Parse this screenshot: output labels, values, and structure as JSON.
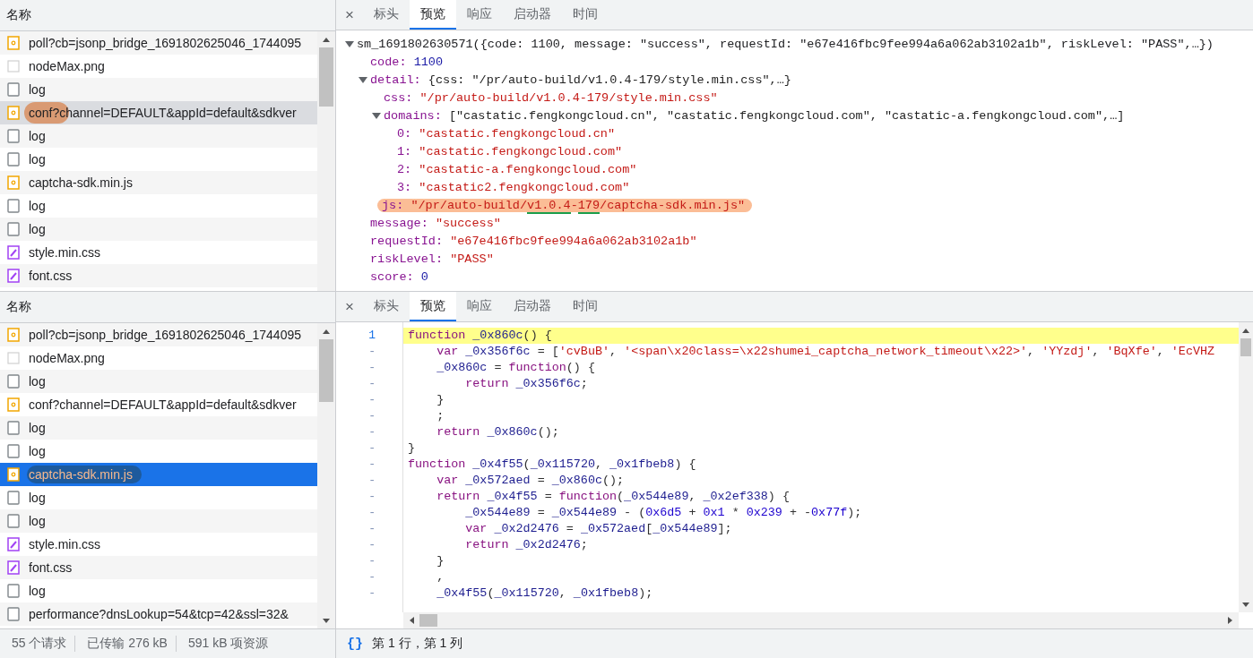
{
  "top": {
    "list": {
      "header": "名称",
      "selection_focused": false,
      "rows": [
        {
          "name": "poll?cb=jsonp_bridge_1691802625046_1744095",
          "kind": "script",
          "selected": false,
          "annotated": false
        },
        {
          "name": "nodeMax.png",
          "kind": "image",
          "selected": false,
          "annotated": false
        },
        {
          "name": "log",
          "kind": "document",
          "selected": false,
          "annotated": false
        },
        {
          "name": "conf?channel=DEFAULT&appId=default&sdkver",
          "kind": "script",
          "selected": true,
          "annotated": true
        },
        {
          "name": "log",
          "kind": "document",
          "selected": false,
          "annotated": false
        },
        {
          "name": "log",
          "kind": "document",
          "selected": false,
          "annotated": false
        },
        {
          "name": "captcha-sdk.min.js",
          "kind": "script",
          "selected": false,
          "annotated": false
        },
        {
          "name": "log",
          "kind": "document",
          "selected": false,
          "annotated": false
        },
        {
          "name": "log",
          "kind": "document",
          "selected": false,
          "annotated": false
        },
        {
          "name": "style.min.css",
          "kind": "stylesheet",
          "selected": false,
          "annotated": false
        },
        {
          "name": "font.css",
          "kind": "stylesheet",
          "selected": false,
          "annotated": false
        }
      ]
    },
    "detail": {
      "close": "×",
      "tabs": [
        {
          "label": "标头",
          "selected": false
        },
        {
          "label": "预览",
          "selected": true
        },
        {
          "label": "响应",
          "selected": false
        },
        {
          "label": "启动器",
          "selected": false
        },
        {
          "label": "时间",
          "selected": false
        }
      ],
      "preview": {
        "label": "sm_1691802630571({code: 1100, message: \"success\", requestId: \"e67e416fbc9fee994a6a062ab3102a1b\", riskLevel: \"PASS\",…})",
        "expanded": true,
        "children": [
          {
            "key": "code:",
            "value": "1100",
            "kind": "number"
          },
          {
            "key": "detail:",
            "value": "{css: \"/pr/auto-build/v1.0.4-179/style.min.css\",…}",
            "kind": "preview",
            "expanded": true,
            "children": [
              {
                "key": "css:",
                "value": "\"/pr/auto-build/v1.0.4-179/style.min.css\"",
                "kind": "string"
              },
              {
                "key": "domains:",
                "value": "[\"castatic.fengkongcloud.cn\", \"castatic.fengkongcloud.com\", \"castatic-a.fengkongcloud.com\",…]",
                "kind": "preview",
                "expanded": true,
                "children": [
                  {
                    "key": "0:",
                    "value": "\"castatic.fengkongcloud.cn\"",
                    "kind": "string"
                  },
                  {
                    "key": "1:",
                    "value": "\"castatic.fengkongcloud.com\"",
                    "kind": "string"
                  },
                  {
                    "key": "2:",
                    "value": "\"castatic-a.fengkongcloud.com\"",
                    "kind": "string"
                  },
                  {
                    "key": "3:",
                    "value": "\"castatic2.fengkongcloud.com\"",
                    "kind": "string"
                  }
                ]
              },
              {
                "key": "js:",
                "kind": "string",
                "annotated": true,
                "value_parts": [
                  {
                    "text": "\"/pr/auto-build/",
                    "underlined": false
                  },
                  {
                    "text": "v1.0.4",
                    "underlined": true
                  },
                  {
                    "text": "-",
                    "underlined": false
                  },
                  {
                    "text": "179",
                    "underlined": true
                  },
                  {
                    "text": "/captcha-sdk.min.js\"",
                    "underlined": false
                  }
                ]
              }
            ]
          },
          {
            "key": "message:",
            "value": "\"success\"",
            "kind": "string"
          },
          {
            "key": "requestId:",
            "value": "\"e67e416fbc9fee994a6a062ab3102a1b\"",
            "kind": "string"
          },
          {
            "key": "riskLevel:",
            "value": "\"PASS\"",
            "kind": "string"
          },
          {
            "key": "score:",
            "value": "0",
            "kind": "number"
          }
        ]
      }
    }
  },
  "bottom": {
    "list": {
      "header": "名称",
      "selection_focused": true,
      "rows": [
        {
          "name": "poll?cb=jsonp_bridge_1691802625046_1744095",
          "kind": "script",
          "selected": false,
          "annotated": false
        },
        {
          "name": "nodeMax.png",
          "kind": "image",
          "selected": false,
          "annotated": false
        },
        {
          "name": "log",
          "kind": "document",
          "selected": false,
          "annotated": false
        },
        {
          "name": "conf?channel=DEFAULT&appId=default&sdkver",
          "kind": "script",
          "selected": false,
          "annotated": false
        },
        {
          "name": "log",
          "kind": "document",
          "selected": false,
          "annotated": false
        },
        {
          "name": "log",
          "kind": "document",
          "selected": false,
          "annotated": false
        },
        {
          "name": "captcha-sdk.min.js",
          "kind": "script",
          "selected": true,
          "annotated": true
        },
        {
          "name": "log",
          "kind": "document",
          "selected": false,
          "annotated": false
        },
        {
          "name": "log",
          "kind": "document",
          "selected": false,
          "annotated": false
        },
        {
          "name": "style.min.css",
          "kind": "stylesheet",
          "selected": false,
          "annotated": false
        },
        {
          "name": "font.css",
          "kind": "stylesheet",
          "selected": false,
          "annotated": false
        },
        {
          "name": "log",
          "kind": "document",
          "selected": false,
          "annotated": false
        },
        {
          "name": "performance?dnsLookup=54&tcp=42&ssl=32&",
          "kind": "document",
          "selected": false,
          "annotated": false
        }
      ],
      "footer": [
        "55 个请求",
        "已传输 276 kB",
        "591 kB 项资源"
      ]
    },
    "detail": {
      "close": "×",
      "tabs": [
        {
          "label": "标头",
          "selected": false
        },
        {
          "label": "预览",
          "selected": true
        },
        {
          "label": "响应",
          "selected": false
        },
        {
          "label": "启动器",
          "selected": false
        },
        {
          "label": "时间",
          "selected": false
        }
      ],
      "code": {
        "lines": [
          {
            "number": "1",
            "highlighted": true,
            "tokens": [
              {
                "kind": "keyword",
                "text": "function"
              },
              {
                "kind": "ident",
                "text": " _0x860c"
              },
              {
                "kind": "punct",
                "text": "() {"
              }
            ]
          },
          {
            "number": "-",
            "highlighted": false,
            "tokens": [
              {
                "kind": "keyword",
                "text": "    var"
              },
              {
                "kind": "ident",
                "text": " _0x356f6c"
              },
              {
                "kind": "punct",
                "text": " = ["
              },
              {
                "kind": "string",
                "text": "'cvBuB'"
              },
              {
                "kind": "punct",
                "text": ", "
              },
              {
                "kind": "string",
                "text": "'<span\\x20class=\\x22shumei_captcha_network_timeout\\x22>'"
              },
              {
                "kind": "punct",
                "text": ", "
              },
              {
                "kind": "string",
                "text": "'YYzdj'"
              },
              {
                "kind": "punct",
                "text": ", "
              },
              {
                "kind": "string",
                "text": "'BqXfe'"
              },
              {
                "kind": "punct",
                "text": ", "
              },
              {
                "kind": "string",
                "text": "'EcVHZ"
              }
            ]
          },
          {
            "number": "-",
            "highlighted": false,
            "tokens": [
              {
                "kind": "ident",
                "text": "    _0x860c"
              },
              {
                "kind": "punct",
                "text": " = "
              },
              {
                "kind": "keyword",
                "text": "function"
              },
              {
                "kind": "punct",
                "text": "() {"
              }
            ]
          },
          {
            "number": "-",
            "highlighted": false,
            "tokens": [
              {
                "kind": "keyword",
                "text": "        return"
              },
              {
                "kind": "ident",
                "text": " _0x356f6c"
              },
              {
                "kind": "punct",
                "text": ";"
              }
            ]
          },
          {
            "number": "-",
            "highlighted": false,
            "tokens": [
              {
                "kind": "punct",
                "text": "    }"
              }
            ]
          },
          {
            "number": "-",
            "highlighted": false,
            "tokens": [
              {
                "kind": "punct",
                "text": "    ;"
              }
            ]
          },
          {
            "number": "-",
            "highlighted": false,
            "tokens": [
              {
                "kind": "keyword",
                "text": "    return"
              },
              {
                "kind": "ident",
                "text": " _0x860c"
              },
              {
                "kind": "punct",
                "text": "();"
              }
            ]
          },
          {
            "number": "-",
            "highlighted": false,
            "tokens": [
              {
                "kind": "punct",
                "text": "}"
              }
            ]
          },
          {
            "number": "-",
            "highlighted": false,
            "tokens": [
              {
                "kind": "keyword",
                "text": "function"
              },
              {
                "kind": "ident",
                "text": " _0x4f55"
              },
              {
                "kind": "punct",
                "text": "("
              },
              {
                "kind": "ident",
                "text": "_0x115720"
              },
              {
                "kind": "punct",
                "text": ", "
              },
              {
                "kind": "ident",
                "text": "_0x1fbeb8"
              },
              {
                "kind": "punct",
                "text": ") {"
              }
            ]
          },
          {
            "number": "-",
            "highlighted": false,
            "tokens": [
              {
                "kind": "keyword",
                "text": "    var"
              },
              {
                "kind": "ident",
                "text": " _0x572aed"
              },
              {
                "kind": "punct",
                "text": " = "
              },
              {
                "kind": "ident",
                "text": "_0x860c"
              },
              {
                "kind": "punct",
                "text": "();"
              }
            ]
          },
          {
            "number": "-",
            "highlighted": false,
            "tokens": [
              {
                "kind": "keyword",
                "text": "    return"
              },
              {
                "kind": "ident",
                "text": " _0x4f55"
              },
              {
                "kind": "punct",
                "text": " = "
              },
              {
                "kind": "keyword",
                "text": "function"
              },
              {
                "kind": "punct",
                "text": "("
              },
              {
                "kind": "ident",
                "text": "_0x544e89"
              },
              {
                "kind": "punct",
                "text": ", "
              },
              {
                "kind": "ident",
                "text": "_0x2ef338"
              },
              {
                "kind": "punct",
                "text": ") {"
              }
            ]
          },
          {
            "number": "-",
            "highlighted": false,
            "tokens": [
              {
                "kind": "ident",
                "text": "        _0x544e89"
              },
              {
                "kind": "punct",
                "text": " = "
              },
              {
                "kind": "ident",
                "text": "_0x544e89"
              },
              {
                "kind": "punct",
                "text": " - ("
              },
              {
                "kind": "number",
                "text": "0x6d5"
              },
              {
                "kind": "punct",
                "text": " + "
              },
              {
                "kind": "number",
                "text": "0x1"
              },
              {
                "kind": "punct",
                "text": " * "
              },
              {
                "kind": "number",
                "text": "0x239"
              },
              {
                "kind": "punct",
                "text": " + -"
              },
              {
                "kind": "number",
                "text": "0x77f"
              },
              {
                "kind": "punct",
                "text": ");"
              }
            ]
          },
          {
            "number": "-",
            "highlighted": false,
            "tokens": [
              {
                "kind": "keyword",
                "text": "        var"
              },
              {
                "kind": "ident",
                "text": " _0x2d2476"
              },
              {
                "kind": "punct",
                "text": " = "
              },
              {
                "kind": "ident",
                "text": "_0x572aed"
              },
              {
                "kind": "punct",
                "text": "["
              },
              {
                "kind": "ident",
                "text": "_0x544e89"
              },
              {
                "kind": "punct",
                "text": "];"
              }
            ]
          },
          {
            "number": "-",
            "highlighted": false,
            "tokens": [
              {
                "kind": "keyword",
                "text": "        return"
              },
              {
                "kind": "ident",
                "text": " _0x2d2476"
              },
              {
                "kind": "punct",
                "text": ";"
              }
            ]
          },
          {
            "number": "-",
            "highlighted": false,
            "tokens": [
              {
                "kind": "punct",
                "text": "    }"
              }
            ]
          },
          {
            "number": "-",
            "highlighted": false,
            "tokens": [
              {
                "kind": "punct",
                "text": "    ,"
              }
            ]
          },
          {
            "number": "-",
            "highlighted": false,
            "tokens": [
              {
                "kind": "ident",
                "text": "    _0x4f55"
              },
              {
                "kind": "punct",
                "text": "("
              },
              {
                "kind": "ident",
                "text": "_0x115720"
              },
              {
                "kind": "punct",
                "text": ", "
              },
              {
                "kind": "ident",
                "text": "_0x1fbeb8"
              },
              {
                "kind": "punct",
                "text": ");"
              }
            ]
          }
        ]
      },
      "status": {
        "format_icon": "{}",
        "position": "第 1 行，第 1 列"
      }
    }
  }
}
